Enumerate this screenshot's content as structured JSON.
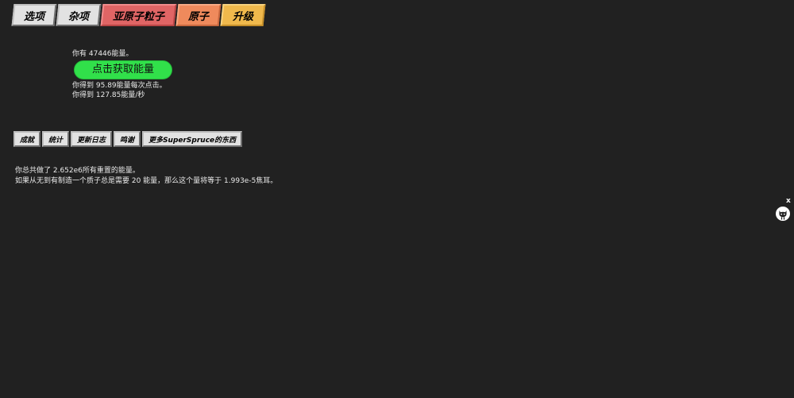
{
  "tabs": [
    {
      "label": "选项",
      "color": "gray"
    },
    {
      "label": "杂项",
      "color": "gray"
    },
    {
      "label": "亚原子粒子",
      "color": "red"
    },
    {
      "label": "原子",
      "color": "orange"
    },
    {
      "label": "升级",
      "color": "yellow"
    }
  ],
  "energy": {
    "have_prefix": "你有 ",
    "amount": "47446",
    "have_suffix": "能量。",
    "button_label": "点击获取能量",
    "per_click_prefix": "你得到 ",
    "per_click": "95.89",
    "per_click_suffix": "能量每次点击。",
    "per_sec_prefix": "你得到 ",
    "per_sec": "127.85",
    "per_sec_suffix": "能量/秒",
    "button_color": "#31e04a"
  },
  "subtabs": [
    "成就",
    "统计",
    "更新日志",
    "鸣谢",
    "更多SuperSpruce的东西"
  ],
  "stats": {
    "line1": "你总共做了 2.652e6所有重置的能量。",
    "line2": "如果从无到有制造一个质子总是需要 20 能量，那么这个量将等于 1.993e-5焦耳。"
  },
  "widget": {
    "close_label": "x",
    "icon": "github-cat-icon"
  }
}
